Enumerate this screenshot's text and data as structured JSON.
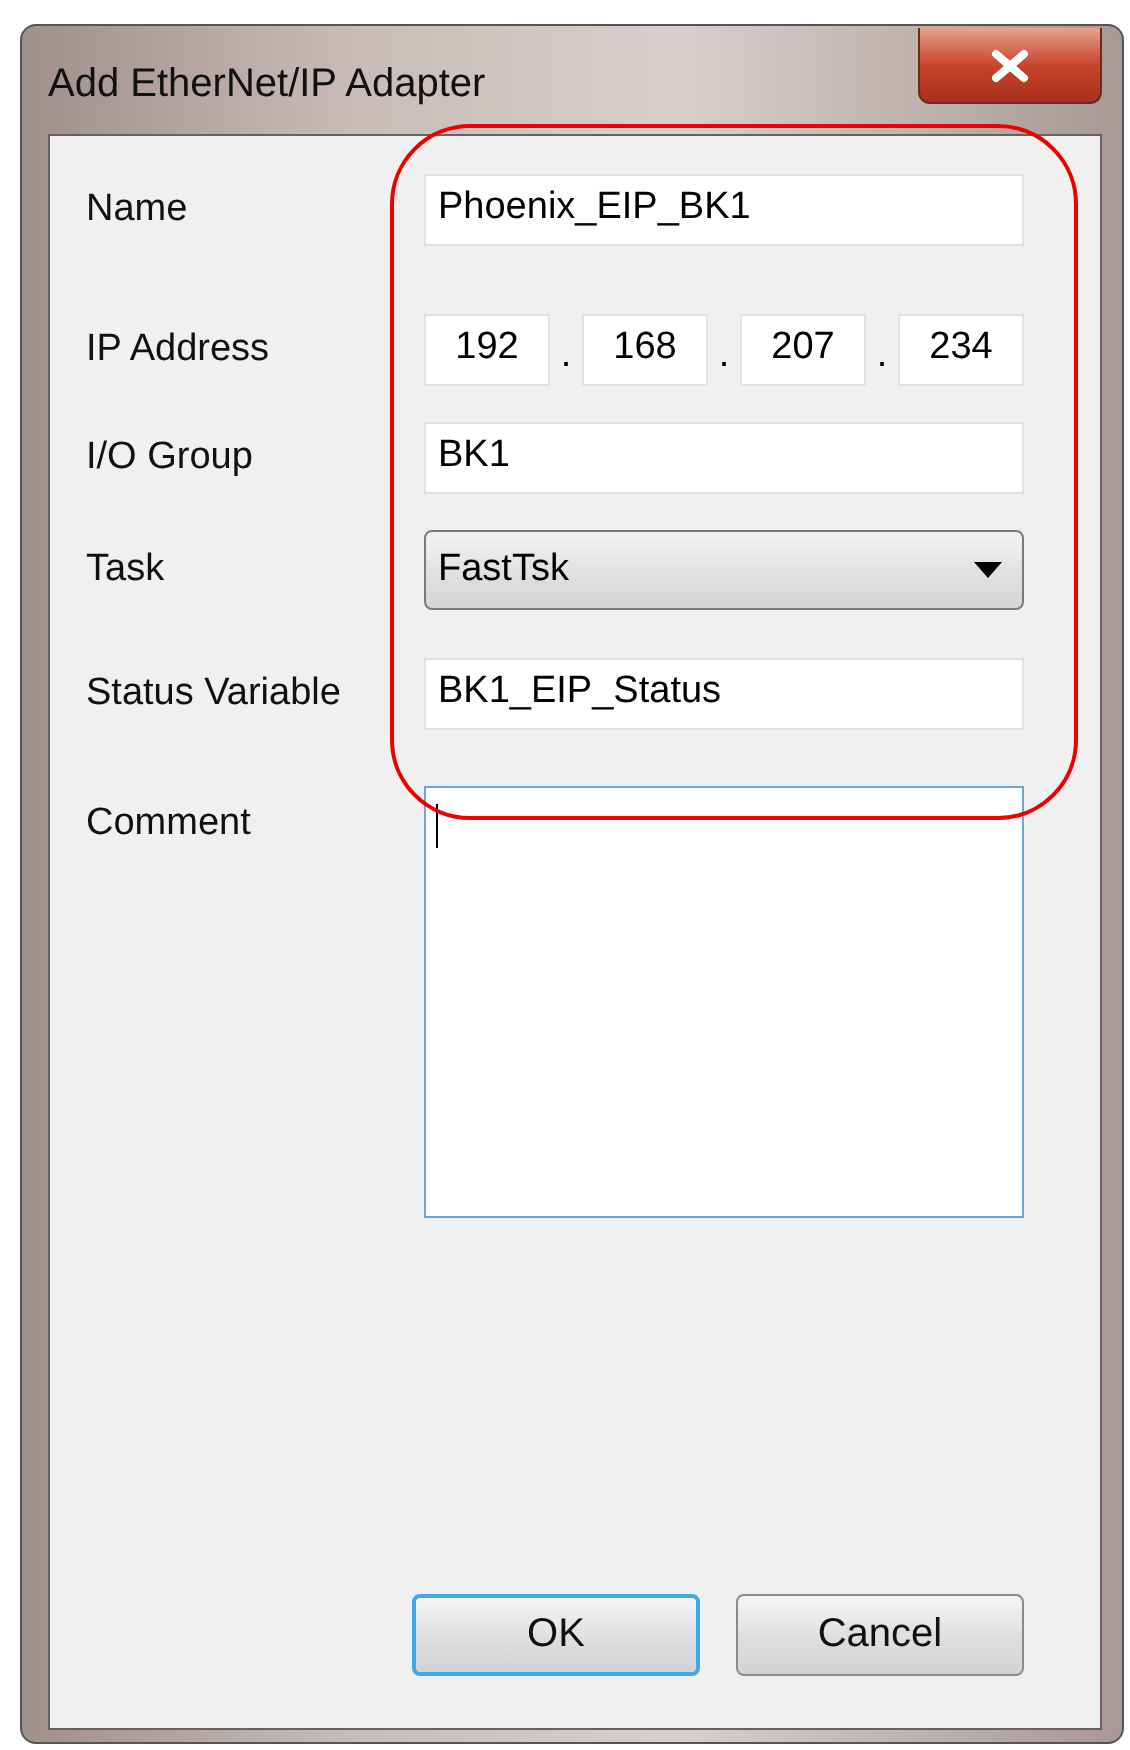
{
  "window": {
    "title": "Add EtherNet/IP Adapter"
  },
  "fields": [
    {
      "kind": "text",
      "label": "Name",
      "value": "Phoenix_EIP_BK1"
    },
    {
      "kind": "ip",
      "label": "IP Address",
      "octets": [
        "192",
        "168",
        "207",
        "234"
      ],
      "separator": "."
    },
    {
      "kind": "text",
      "label": "I/O Group",
      "value": "BK1"
    },
    {
      "kind": "dropdown",
      "label": "Task",
      "value": "FastTsk"
    },
    {
      "kind": "text",
      "label": "Status Variable",
      "value": "BK1_EIP_Status"
    },
    {
      "kind": "multiline",
      "label": "Comment",
      "focused": true
    }
  ],
  "buttons": [
    {
      "label": "OK",
      "default": true
    },
    {
      "label": "Cancel",
      "default": false
    }
  ]
}
